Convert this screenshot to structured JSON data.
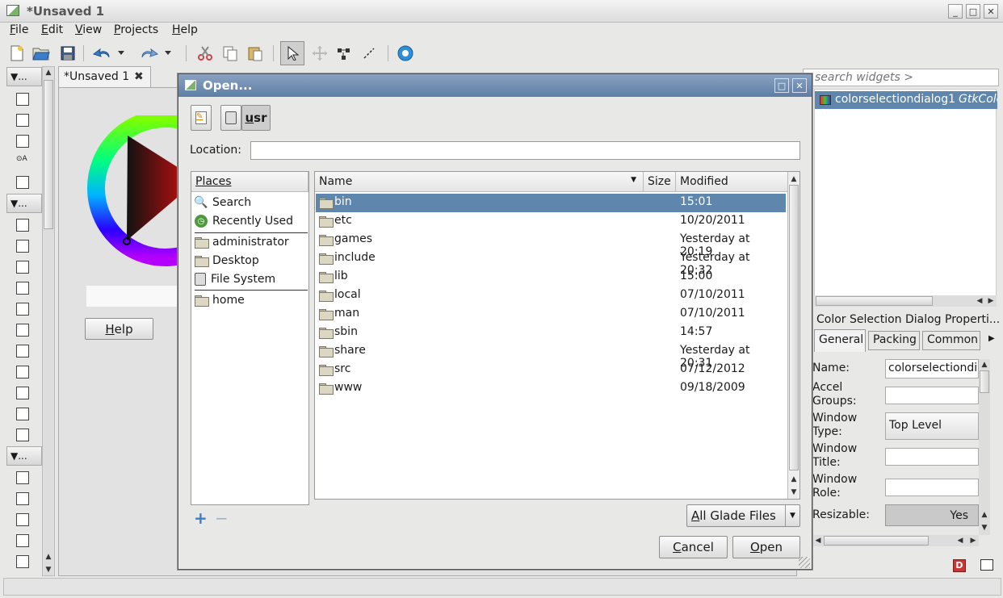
{
  "app": {
    "title": "*Unsaved 1",
    "window_buttons": [
      "_",
      "□",
      "✕"
    ]
  },
  "menu": [
    "File",
    "Edit",
    "View",
    "Projects",
    "Help"
  ],
  "toolbar": {
    "icons": [
      "new-icon",
      "open-icon",
      "save-icon",
      "undo-icon",
      "undo-dropdown-icon",
      "redo-icon",
      "redo-dropdown-icon",
      "cut-icon",
      "copy-icon",
      "paste-icon",
      "pointer-icon",
      "drag-resize-icon",
      "edit-icon",
      "margin-icon",
      "settings-icon"
    ]
  },
  "palette": {
    "group_labels": [
      "...",
      "...",
      "..."
    ]
  },
  "design": {
    "tab_label": "*Unsaved 1",
    "help_button": "Help"
  },
  "right": {
    "search_placeholder": "search widgets >",
    "tree_item": "colorselectiondialog1",
    "tree_item_type": "GtkColo",
    "props_title": "Color Selection Dialog Properti...",
    "tabs": [
      "General",
      "Packing",
      "Common"
    ],
    "props": [
      {
        "label": "Name:",
        "value": "colorselectiondia"
      },
      {
        "label": "Accel\nGroups:",
        "value": ""
      },
      {
        "label": "Window\nType:",
        "value": "Top Level"
      },
      {
        "label": "Window\nTitle:",
        "value": ""
      },
      {
        "label": "Window\nRole:",
        "value": ""
      },
      {
        "label": "Resizable:",
        "value": "Yes"
      }
    ]
  },
  "dialog": {
    "title": "Open...",
    "path_button": "usr",
    "location_label": "Location:",
    "location_value": "",
    "places_header": "Places",
    "places": [
      {
        "label": "Search",
        "icon": "search-icon"
      },
      {
        "label": "Recently Used",
        "icon": "recent-icon"
      },
      {
        "label": "administrator",
        "icon": "folder-icon"
      },
      {
        "label": "Desktop",
        "icon": "folder-icon"
      },
      {
        "label": "File System",
        "icon": "drive-icon"
      },
      {
        "label": "home",
        "icon": "folder-icon"
      }
    ],
    "columns": {
      "name": "Name",
      "size": "Size",
      "modified": "Modified"
    },
    "files": [
      {
        "name": "bin",
        "modified": "15:01",
        "selected": true
      },
      {
        "name": "etc",
        "modified": "10/20/2011"
      },
      {
        "name": "games",
        "modified": "Yesterday at 20:19"
      },
      {
        "name": "include",
        "modified": "Yesterday at 20:32"
      },
      {
        "name": "lib",
        "modified": "15:00"
      },
      {
        "name": "local",
        "modified": "07/10/2011"
      },
      {
        "name": "man",
        "modified": "07/10/2011"
      },
      {
        "name": "sbin",
        "modified": "14:57"
      },
      {
        "name": "share",
        "modified": "Yesterday at 20:31"
      },
      {
        "name": "src",
        "modified": "07/12/2012"
      },
      {
        "name": "www",
        "modified": "09/18/2009"
      }
    ],
    "filter": "All Glade Files",
    "cancel": "Cancel",
    "open": "Open"
  },
  "colors": {
    "selection": "#5f86ad",
    "dialog_title": "#6a88ad"
  }
}
